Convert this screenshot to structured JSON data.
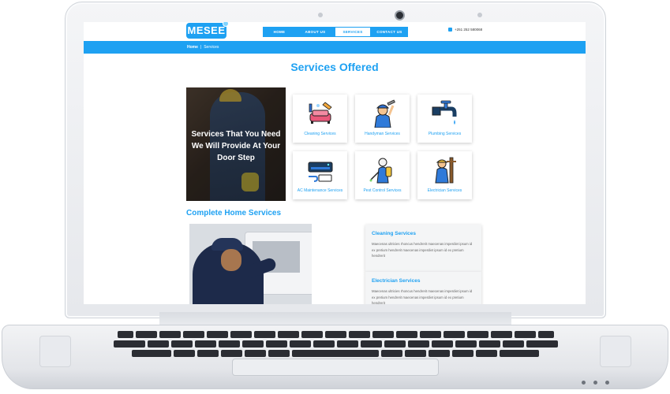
{
  "header": {
    "logo": "MESEE",
    "nav": [
      {
        "label": "HOME",
        "active": false
      },
      {
        "label": "ABOUT US",
        "active": false
      },
      {
        "label": "SERVICES",
        "active": true
      },
      {
        "label": "CONTACT US",
        "active": false
      }
    ],
    "phone": "+251 252 580068"
  },
  "breadcrumb": {
    "home": "Home",
    "separator": "|",
    "current": "Services"
  },
  "main": {
    "title": "Services Offered",
    "hero_text": "Services That You Need We Will Provide At Your Door Step",
    "services": [
      {
        "label": "Cleaning Services",
        "icon": "sofa-cleaning-icon"
      },
      {
        "label": "Handyman Services",
        "icon": "handyman-icon"
      },
      {
        "label": "Plumbing Services",
        "icon": "faucet-icon"
      },
      {
        "label": "AC Maintenance Services",
        "icon": "air-conditioner-icon"
      },
      {
        "label": "Pest Control Services",
        "icon": "pest-sprayer-icon"
      },
      {
        "label": "Electrician Services",
        "icon": "electrician-icon"
      }
    ],
    "sub_title": "Complete Home Services",
    "detail_cards": [
      {
        "title": "Cleaning Services",
        "text": "Maecenas ultricies rhoncus hendrerit maecenas imperdiet ipsum id ex pretium hendrerit maecenas imperdiet ipsum id ex pretium hendrerit"
      },
      {
        "title": "Electrician Services",
        "text": "Maecenas ultricies rhoncus hendrerit maecenas imperdiet ipsum id ex pretium hendrerit maecenas imperdiet ipsum id ex pretium hendrerit"
      }
    ]
  },
  "colors": {
    "accent": "#1ea1f2"
  }
}
